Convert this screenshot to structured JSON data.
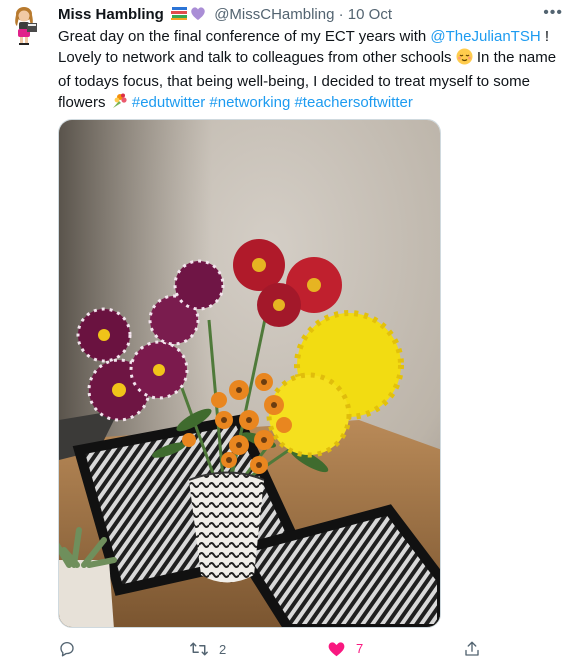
{
  "tweet": {
    "author_name": "Miss Hambling",
    "handle": "@MissCHambling",
    "separator": "·",
    "date": "10 Oct",
    "more_label": "•••",
    "text_part1": "Great day on the final conference of my ECT years with ",
    "mention": "@TheJulianTSH",
    "text_part2": " ! Lovely to network and talk to colleagues from other schools ",
    "text_part3": " In the name of todays focus, that being well-being, I decided to treat myself to some flowers ",
    "hashtags": [
      "#edutwitter",
      "#networking",
      "#teachersoftwitter"
    ]
  },
  "actions": {
    "retweets": "2",
    "likes": "7"
  },
  "colors": {
    "link": "#1d9bf0",
    "like": "#f91880",
    "muted": "#536471"
  }
}
